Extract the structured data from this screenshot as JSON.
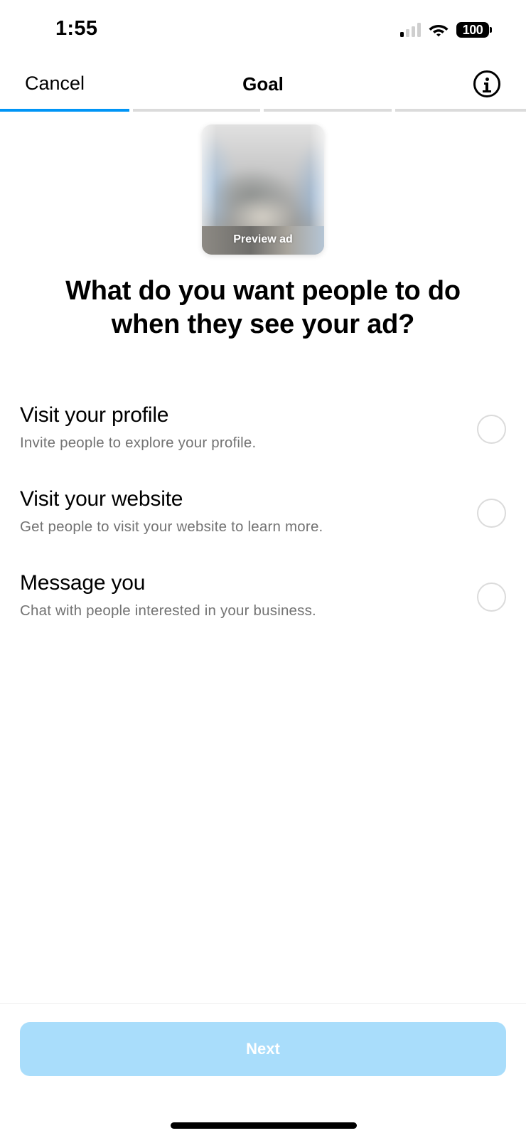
{
  "status_bar": {
    "time": "1:55",
    "signal_bars_active": 1,
    "signal_bars_total": 4,
    "wifi_icon": "wifi-icon",
    "battery_level": "100"
  },
  "header": {
    "cancel_label": "Cancel",
    "title": "Goal",
    "info_icon": "info-icon"
  },
  "progress": {
    "current_step": 1,
    "total_steps": 4,
    "active_color": "#0095f6",
    "inactive_color": "#dbdbdb"
  },
  "preview": {
    "label": "Preview ad"
  },
  "main": {
    "heading": "What do you want people to do when they see your ad?",
    "options": [
      {
        "title": "Visit your profile",
        "description": "Invite people to explore your profile.",
        "selected": false
      },
      {
        "title": "Visit your website",
        "description": "Get people to visit your website to learn more.",
        "selected": false
      },
      {
        "title": "Message you",
        "description": "Chat with people interested in your business.",
        "selected": false
      }
    ]
  },
  "footer": {
    "next_label": "Next",
    "next_enabled": false,
    "next_color": "#a9ddfb"
  }
}
